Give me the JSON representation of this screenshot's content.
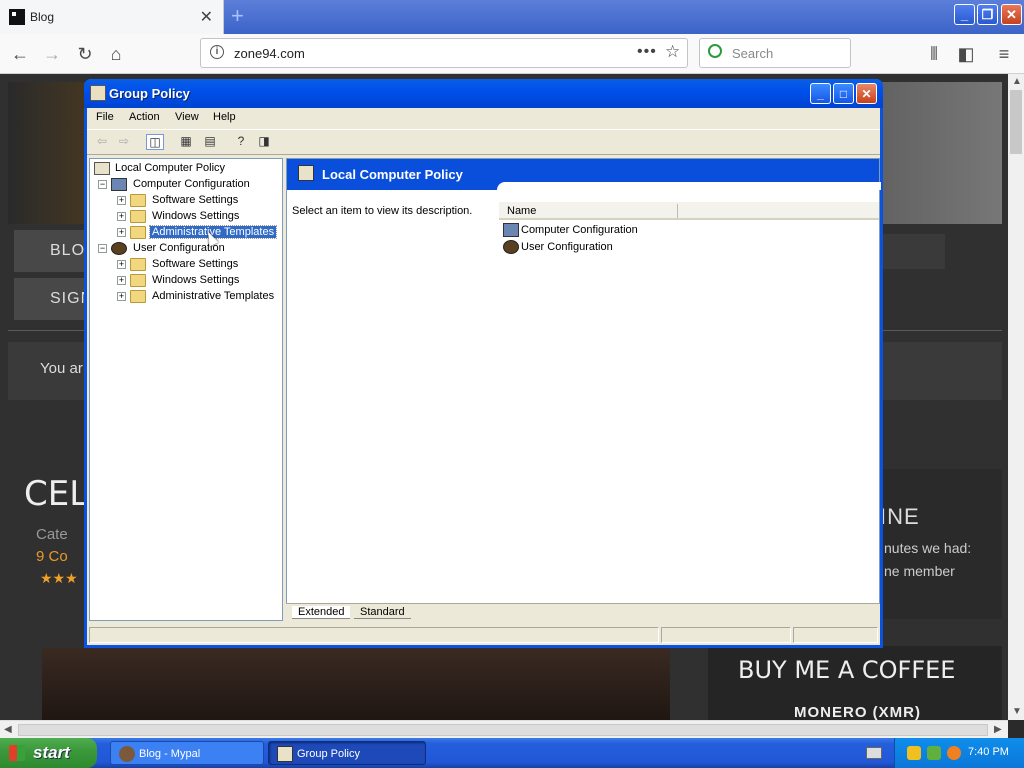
{
  "browser": {
    "tab_title": "Blog",
    "tab_close": "✕",
    "new_tab": "+",
    "url": "zone94.com",
    "page_actions": "•••",
    "search_placeholder": "Search"
  },
  "webpage": {
    "nav1": "BLO",
    "nav2": "SIGN",
    "notice": "You ar",
    "post_title": "CELL",
    "category": "Cate",
    "comments": "9 Co",
    "stars": "★★★",
    "side_title": "INE",
    "side_text1": "nutes we had:",
    "side_text2": "ne member",
    "coffee_title": "BUY ME A COFFEE",
    "coffee_currency": "MONERO (XMR)"
  },
  "gp_window": {
    "title": "Group Policy",
    "menu": [
      "File",
      "Action",
      "View",
      "Help"
    ],
    "tree": {
      "root": "Local Computer Policy",
      "computer": "Computer Configuration",
      "computer_children": [
        "Software Settings",
        "Windows Settings",
        "Administrative Templates"
      ],
      "user": "User Configuration",
      "user_children": [
        "Software Settings",
        "Windows Settings",
        "Administrative Templates"
      ]
    },
    "right_header": "Local Computer Policy",
    "description": "Select an item to view its description.",
    "column_name": "Name",
    "items": [
      "Computer Configuration",
      "User Configuration"
    ],
    "tabs": [
      "Extended",
      "Standard"
    ]
  },
  "taskbar": {
    "start": "start",
    "buttons": [
      "Blog - Mypal",
      "Group Policy"
    ],
    "clock": "7:40 PM"
  }
}
